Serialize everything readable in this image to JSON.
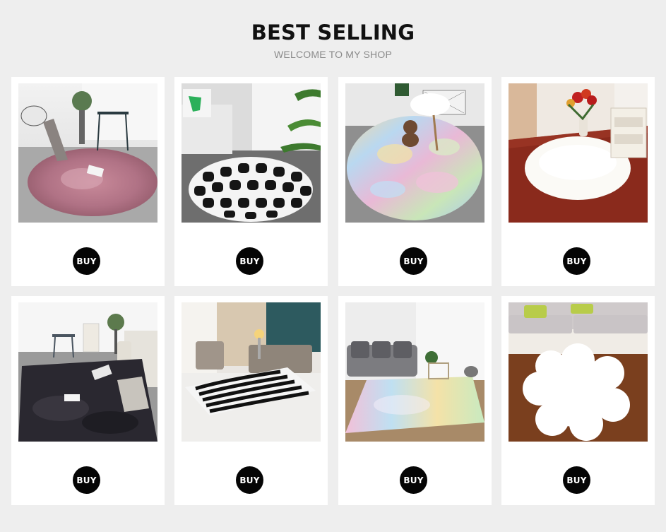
{
  "header": {
    "title": "BEST SELLING",
    "subtitle": "WELCOME TO MY SHOP"
  },
  "products": [
    {
      "image": "pink-round-shag-rug-photo",
      "buy_label": "BUY"
    },
    {
      "image": "black-white-moroccan-round-rug-photo",
      "buy_label": "BUY"
    },
    {
      "image": "rainbow-tie-dye-round-rug-photo",
      "buy_label": "BUY"
    },
    {
      "image": "white-round-faux-fur-rug-photo",
      "buy_label": "BUY"
    },
    {
      "image": "dark-grey-shag-area-rug-photo",
      "buy_label": "BUY"
    },
    {
      "image": "zebra-stripe-rug-photo",
      "buy_label": "BUY"
    },
    {
      "image": "pastel-rainbow-area-rug-photo",
      "buy_label": "BUY"
    },
    {
      "image": "white-flower-shaped-fur-rug-photo",
      "buy_label": "BUY"
    }
  ]
}
